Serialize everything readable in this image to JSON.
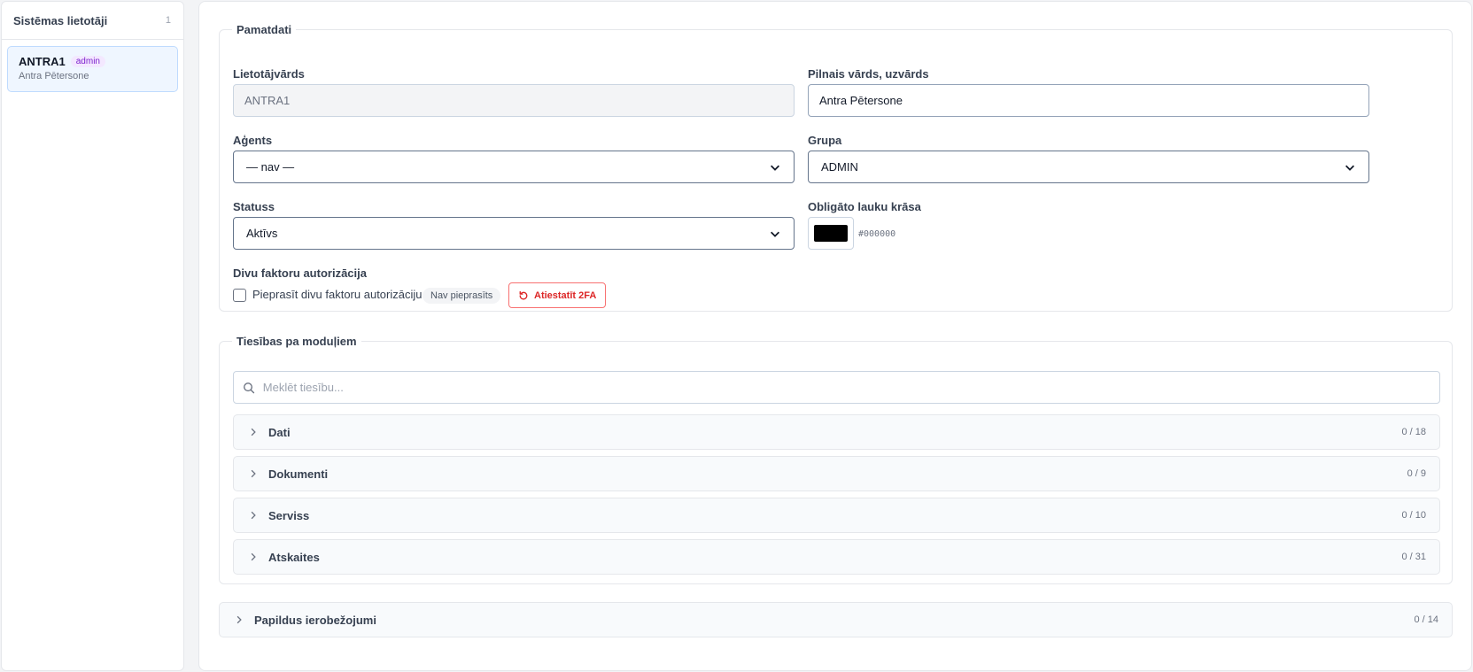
{
  "sidebar": {
    "title": "Sistēmas lietotāji",
    "count": "1",
    "users": [
      {
        "username": "ANTRA1",
        "badge": "admin",
        "full_name": "Antra Pētersone"
      }
    ]
  },
  "basic": {
    "legend": "Pamatdati",
    "username": {
      "label": "Lietotājvārds",
      "value": "ANTRA1"
    },
    "full_name": {
      "label": "Pilnais vārds, uzvārds",
      "value": "Antra Pētersone"
    },
    "agent": {
      "label": "Aģents",
      "value": "— nav —"
    },
    "group": {
      "label": "Grupa",
      "value": "ADMIN"
    },
    "status": {
      "label": "Statuss",
      "value": "Aktīvs"
    },
    "required_color": {
      "label": "Obligāto lauku krāsa",
      "value": "#000000"
    },
    "twofa": {
      "label": "Divu faktoru autorizācija",
      "checkbox_label": "Pieprasīt divu faktoru autorizāciju",
      "status_pill": "Nav pieprasīts",
      "reset_button": "Atiestatīt 2FA"
    }
  },
  "permissions": {
    "legend": "Tiesības pa moduļiem",
    "search_placeholder": "Meklēt tiesību...",
    "modules": [
      {
        "label": "Dati",
        "count": "0 / 18"
      },
      {
        "label": "Dokumenti",
        "count": "0 / 9"
      },
      {
        "label": "Serviss",
        "count": "0 / 10"
      },
      {
        "label": "Atskaites",
        "count": "0 / 31"
      }
    ]
  },
  "extra": {
    "label": "Papildus ierobežojumi",
    "count": "0 / 14"
  }
}
